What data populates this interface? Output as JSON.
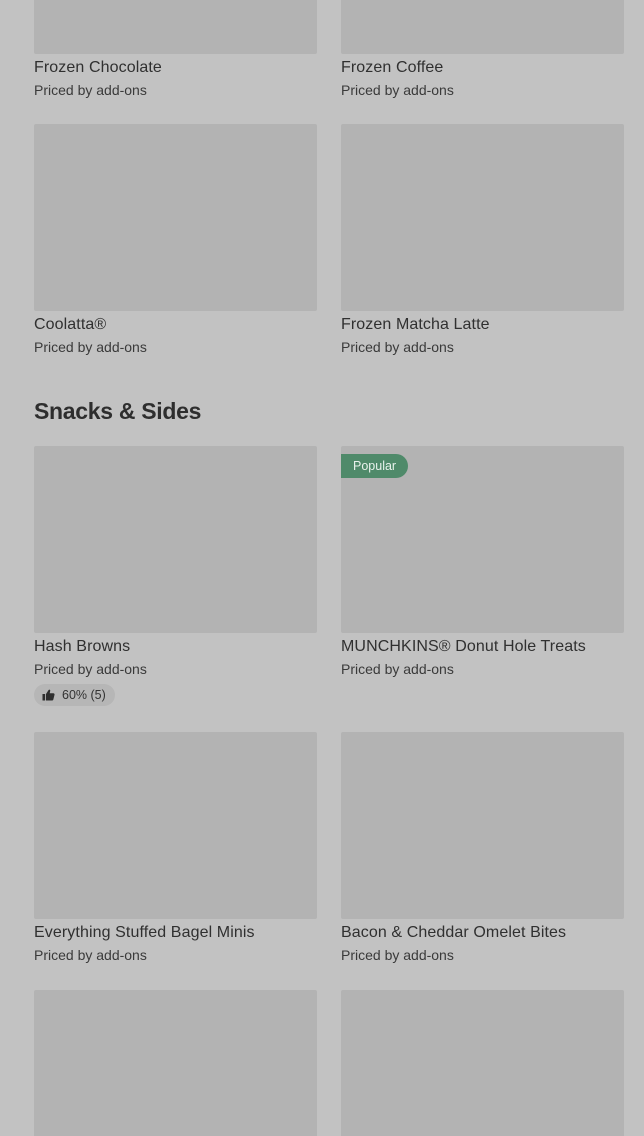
{
  "top_row": [
    {
      "name": "Frozen Chocolate",
      "price": "Priced by add-ons"
    },
    {
      "name": "Frozen Coffee",
      "price": "Priced by add-ons"
    }
  ],
  "row2": [
    {
      "name": "Coolatta®",
      "price": "Priced by add-ons"
    },
    {
      "name": "Frozen Matcha Latte",
      "price": "Priced by add-ons"
    }
  ],
  "section": {
    "title": "Snacks & Sides"
  },
  "row3": [
    {
      "name": "Hash Browns",
      "price": "Priced by add-ons",
      "rating": "60% (5)"
    },
    {
      "name": "MUNCHKINS® Donut Hole Treats",
      "price": "Priced by add-ons",
      "badge": "Popular"
    }
  ],
  "row4": [
    {
      "name": "Everything Stuffed Bagel Minis",
      "price": "Priced by add-ons"
    },
    {
      "name": "Bacon & Cheddar Omelet Bites",
      "price": "Priced by add-ons"
    }
  ],
  "colors": {
    "background": "#c2c2c2",
    "image_placeholder": "#b3b3b3",
    "popular_badge": "#4f8a6a"
  },
  "icons": {
    "rating": "thumbs-up-icon"
  }
}
